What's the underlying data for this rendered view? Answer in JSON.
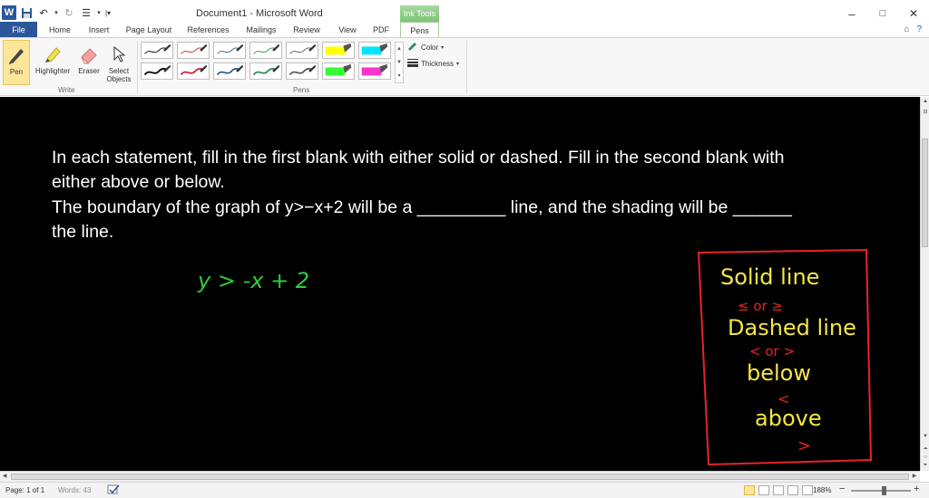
{
  "titlebar": {
    "logo_letter": "W",
    "title": "Document1  -  Microsoft Word",
    "ink_tools": "Ink Tools",
    "minimize": "–",
    "maximize": "□",
    "close": "✕"
  },
  "tabs": {
    "file": "File",
    "home": "Home",
    "insert": "Insert",
    "page_layout": "Page Layout",
    "references": "References",
    "mailings": "Mailings",
    "review": "Review",
    "view": "View",
    "pdf": "PDF",
    "pens": "Pens"
  },
  "ribbon": {
    "pen": "Pen",
    "highlighter": "Highlighter",
    "eraser": "Eraser",
    "select_line1": "Select",
    "select_line2": "Objects",
    "write_group": "Write",
    "pens_group": "Pens",
    "color": "Color",
    "thickness": "Thickness",
    "pen_styles": [
      {
        "color": "#000000",
        "type": "pen"
      },
      {
        "color": "#c0282d",
        "type": "pen"
      },
      {
        "color": "#2f5f8a",
        "type": "pen"
      },
      {
        "color": "#2e8b57",
        "type": "pen"
      },
      {
        "color": "#5a5a5a",
        "type": "pen"
      },
      {
        "color": "#ffff00",
        "type": "highlighter"
      },
      {
        "color": "#00e5ff",
        "type": "highlighter"
      },
      {
        "color": "#000000",
        "type": "pen"
      },
      {
        "color": "#c0282d",
        "type": "pen"
      },
      {
        "color": "#2f5f8a",
        "type": "pen"
      },
      {
        "color": "#2e8b57",
        "type": "pen"
      },
      {
        "color": "#5a5a5a",
        "type": "pen"
      },
      {
        "color": "#33ff33",
        "type": "highlighter"
      },
      {
        "color": "#ff33cc",
        "type": "highlighter"
      }
    ]
  },
  "document": {
    "line1": "In each statement, fill in the first blank with either solid or dashed. Fill in the second blank with",
    "line2": "either above or below.",
    "line3": "The boundary of the graph of y>−x+2 will be a _________ line, and the shading will be ______",
    "line4": "the line."
  },
  "ink": {
    "equation": "y > -x + 2",
    "solid_line": "Solid line",
    "or_1": "≤ or ≥",
    "dashed_line": "Dashed line",
    "or_2": "< or >",
    "below": "below",
    "below_symbol": "<",
    "above": "above",
    "above_symbol": ">",
    "green": "#2ecc40",
    "yellow": "#f5e642",
    "red": "#e8232a"
  },
  "status": {
    "page": "Page: 1 of 1",
    "words": "Words: 43",
    "zoom": "188%",
    "zoom_minus": "−",
    "zoom_plus": "+",
    "zoom_level": 0.55
  }
}
